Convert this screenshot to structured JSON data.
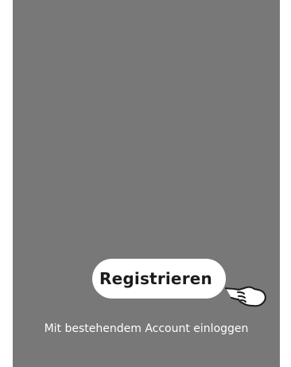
{
  "auth": {
    "register_label": "Registrieren",
    "login_link_label": "Mit bestehendem Account einloggen"
  },
  "icons": {
    "pointer": "pointing-hand-icon"
  },
  "colors": {
    "background": "#787878",
    "button": "#ffffff",
    "button_text": "#1c1c1c",
    "link_text": "#ffffff"
  }
}
